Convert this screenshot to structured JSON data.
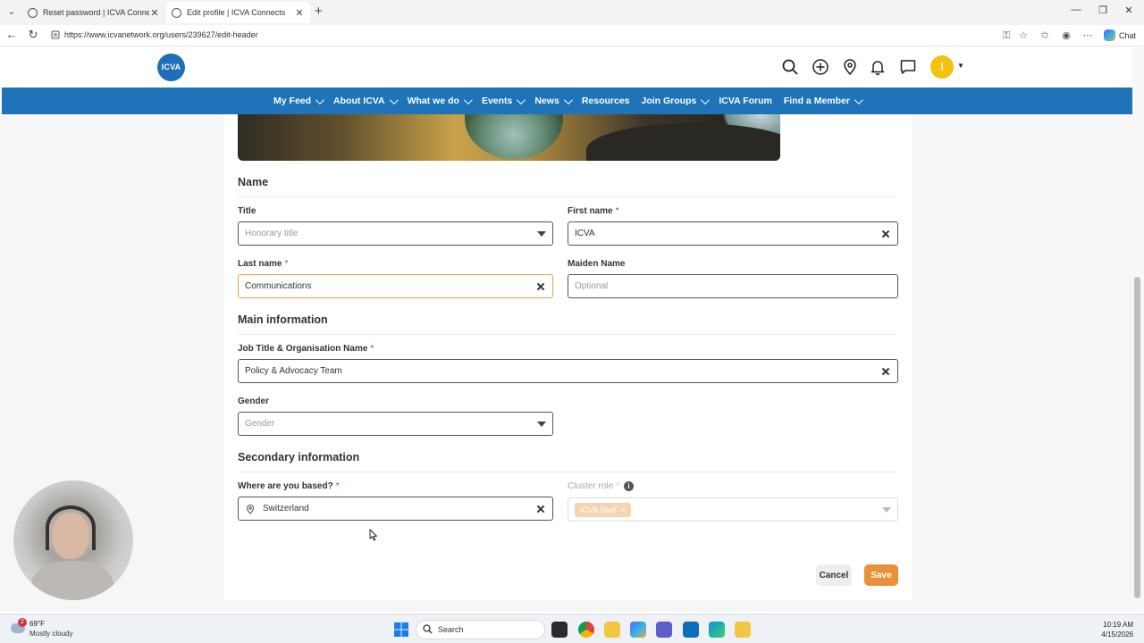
{
  "browser": {
    "tabs": [
      {
        "title": "Reset password | ICVA Connects",
        "active": false
      },
      {
        "title": "Edit profile | ICVA Connects",
        "active": true
      }
    ],
    "url": "https://www.icvanetwork.org/users/239627/edit-header",
    "chat_label": "Chat"
  },
  "site": {
    "logo_text": "ICVA",
    "avatar_initial": "I",
    "nav": [
      {
        "label": "My Feed",
        "has_dropdown": true
      },
      {
        "label": "About ICVA",
        "has_dropdown": true
      },
      {
        "label": "What we do",
        "has_dropdown": true
      },
      {
        "label": "Events",
        "has_dropdown": true
      },
      {
        "label": "News",
        "has_dropdown": true
      },
      {
        "label": "Resources",
        "has_dropdown": false
      },
      {
        "label": "Join Groups",
        "has_dropdown": true
      },
      {
        "label": "ICVA Forum",
        "has_dropdown": false
      },
      {
        "label": "Find a Member",
        "has_dropdown": true
      }
    ]
  },
  "form": {
    "name_section": "Name",
    "title_label": "Title",
    "title_placeholder": "Honorary title",
    "first_name_label": "First name",
    "first_name_value": "ICVA",
    "last_name_label": "Last name",
    "last_name_value": "Communications",
    "maiden_label": "Maiden Name",
    "maiden_placeholder": "Optional",
    "main_section": "Main information",
    "job_label": "Job Title & Organisation Name",
    "job_value": "Policy & Advocacy Team",
    "gender_label": "Gender",
    "gender_placeholder": "Gender",
    "secondary_section": "Secondary information",
    "based_label": "Where are you based?",
    "based_value": "Switzerland",
    "cluster_label": "Cluster role",
    "cluster_chip": "ICVA Staff",
    "required_mark": "*",
    "cancel": "Cancel",
    "save": "Save"
  },
  "taskbar": {
    "temperature": "69°F",
    "condition": "Mostly cloudy",
    "weather_badge": "2",
    "search": "Search",
    "time": "10:19 AM",
    "date": "4/15/2026"
  },
  "colors": {
    "nav_blue": "#1e73b9",
    "accent_orange": "#e8913a",
    "avatar_yellow": "#f4c10f"
  }
}
